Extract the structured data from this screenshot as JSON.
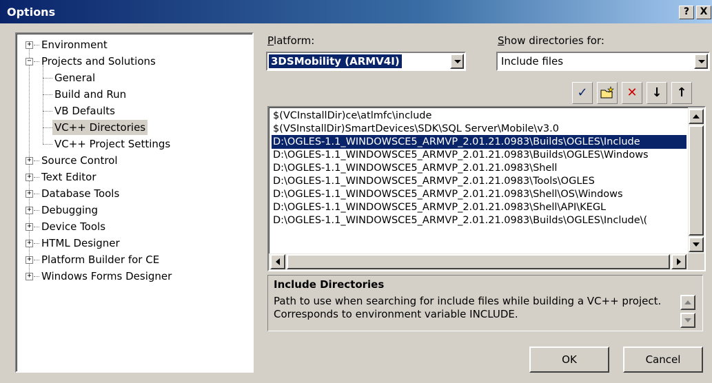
{
  "window": {
    "title": "Options",
    "help_button": "?",
    "close_button": "X"
  },
  "tree": {
    "items": [
      {
        "label": "Environment",
        "expander": "+"
      },
      {
        "label": "Projects and Solutions",
        "expander": "−"
      },
      {
        "label": "General"
      },
      {
        "label": "Build and Run"
      },
      {
        "label": "VB Defaults"
      },
      {
        "label": "VC++ Directories",
        "selected": true
      },
      {
        "label": "VC++ Project Settings"
      },
      {
        "label": "Source Control",
        "expander": "+"
      },
      {
        "label": "Text Editor",
        "expander": "+"
      },
      {
        "label": "Database Tools",
        "expander": "+"
      },
      {
        "label": "Debugging",
        "expander": "+"
      },
      {
        "label": "Device Tools",
        "expander": "+"
      },
      {
        "label": "HTML Designer",
        "expander": "+"
      },
      {
        "label": "Platform Builder for CE",
        "expander": "+"
      },
      {
        "label": "Windows Forms Designer",
        "expander": "+"
      }
    ]
  },
  "platform": {
    "label_key": "P",
    "label_rest": "latform:",
    "value": "3DSMobility (ARMV4I)"
  },
  "show_dirs": {
    "label_key": "S",
    "label_rest": "how directories for:",
    "value": "Include files"
  },
  "toolbar": {
    "check_icon": "checkmark-icon",
    "new_folder_icon": "new-folder-icon",
    "delete_icon": "delete-icon",
    "down_icon": "move-down-icon",
    "up_icon": "move-up-icon",
    "check_glyph": "✓",
    "delete_glyph": "✕",
    "down_glyph": "↓",
    "up_glyph": "↑",
    "check_color": "#0a246a",
    "delete_color": "#cc0000"
  },
  "directories": [
    "$(VCInstallDir)ce\\atlmfc\\include",
    "$(VSInstallDir)SmartDevices\\SDK\\SQL Server\\Mobile\\v3.0",
    "D:\\OGLES-1.1_WINDOWSCE5_ARMVP_2.01.21.0983\\Builds\\OGLES\\Include",
    "D:\\OGLES-1.1_WINDOWSCE5_ARMVP_2.01.21.0983\\Builds\\OGLES\\Windows",
    "D:\\OGLES-1.1_WINDOWSCE5_ARMVP_2.01.21.0983\\Shell",
    "D:\\OGLES-1.1_WINDOWSCE5_ARMVP_2.01.21.0983\\Tools\\OGLES",
    "D:\\OGLES-1.1_WINDOWSCE5_ARMVP_2.01.21.0983\\Shell\\OS\\Windows",
    "D:\\OGLES-1.1_WINDOWSCE5_ARMVP_2.01.21.0983\\Shell\\API\\KEGL",
    "D:\\OGLES-1.1_WINDOWSCE5_ARMVP_2.01.21.0983\\Builds\\OGLES\\Include\\("
  ],
  "selected_directory_index": 2,
  "description": {
    "title": "Include Directories",
    "line1": "Path to use when searching for include files while building a VC++ project.",
    "line2": "Corresponds to environment variable INCLUDE."
  },
  "buttons": {
    "ok": "OK",
    "cancel": "Cancel"
  }
}
